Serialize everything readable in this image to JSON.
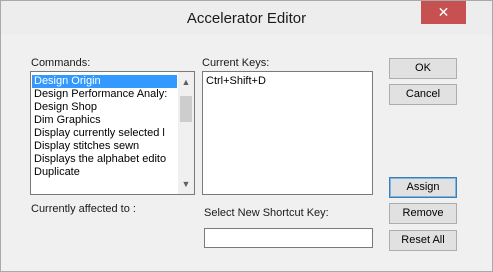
{
  "window": {
    "title": "Accelerator Editor",
    "close_symbol": "✕"
  },
  "commands": {
    "label": "Commands:",
    "items": [
      "Design Origin",
      "Design Performance Analy:",
      "Design Shop",
      "Dim Graphics",
      "Display currently selected l",
      "Display stitches sewn",
      "Displays the alphabet edito",
      "Duplicate"
    ],
    "selected": "Design Origin"
  },
  "current_keys": {
    "label": "Current Keys:",
    "items": [
      "Ctrl+Shift+D"
    ]
  },
  "affected": {
    "label": "Currently affected to :"
  },
  "shortcut": {
    "label": "Select New Shortcut Key:",
    "value": ""
  },
  "buttons": {
    "ok": "OK",
    "cancel": "Cancel",
    "assign": "Assign",
    "remove": "Remove",
    "reset_all": "Reset All"
  },
  "icons": {
    "scroll_up": "chevron-up-icon",
    "scroll_down": "chevron-down-icon",
    "close": "close-icon"
  },
  "colors": {
    "selection": "#3399ff",
    "close_button": "#c75050"
  }
}
